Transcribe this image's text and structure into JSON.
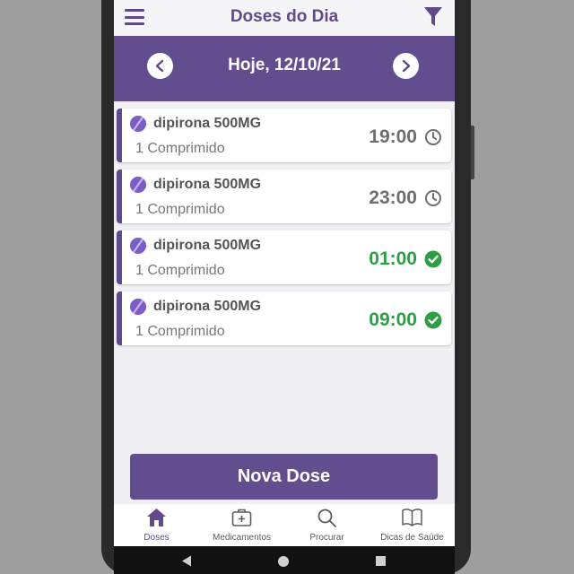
{
  "app": {
    "title": "Doses do Dia",
    "icons": {
      "menu": "hamburger-menu-icon",
      "filter": "filter-icon"
    }
  },
  "date_bar": {
    "label": "Hoje, 12/10/21",
    "icons": {
      "prev": "chevron-left-icon",
      "next": "chevron-right-icon"
    }
  },
  "doses": [
    {
      "name": "dipirona 500MG",
      "quantity": "1 Comprimido",
      "time": "19:00",
      "status": "pending",
      "status_icon": "clock-icon"
    },
    {
      "name": "dipirona 500MG",
      "quantity": "1 Comprimido",
      "time": "23:00",
      "status": "pending",
      "status_icon": "clock-icon"
    },
    {
      "name": "dipirona 500MG",
      "quantity": "1 Comprimido",
      "time": "01:00",
      "status": "taken",
      "status_icon": "check-circle-icon"
    },
    {
      "name": "dipirona 500MG",
      "quantity": "1 Comprimido",
      "time": "09:00",
      "status": "taken",
      "status_icon": "check-circle-icon"
    }
  ],
  "new_dose_button": "Nova Dose",
  "bottom_nav": [
    {
      "label": "Doses",
      "icon": "home-icon",
      "active": true
    },
    {
      "label": "Medicamentos",
      "icon": "first-aid-kit-icon",
      "active": false
    },
    {
      "label": "Procurar",
      "icon": "search-icon",
      "active": false
    },
    {
      "label": "Dicas de Saúde",
      "icon": "book-icon",
      "active": false
    }
  ],
  "colors": {
    "primary": "#61498d",
    "header_band": "#624e8f",
    "taken": "#2e9e44",
    "pending": "#6e6e6e",
    "background": "#efeff4"
  }
}
